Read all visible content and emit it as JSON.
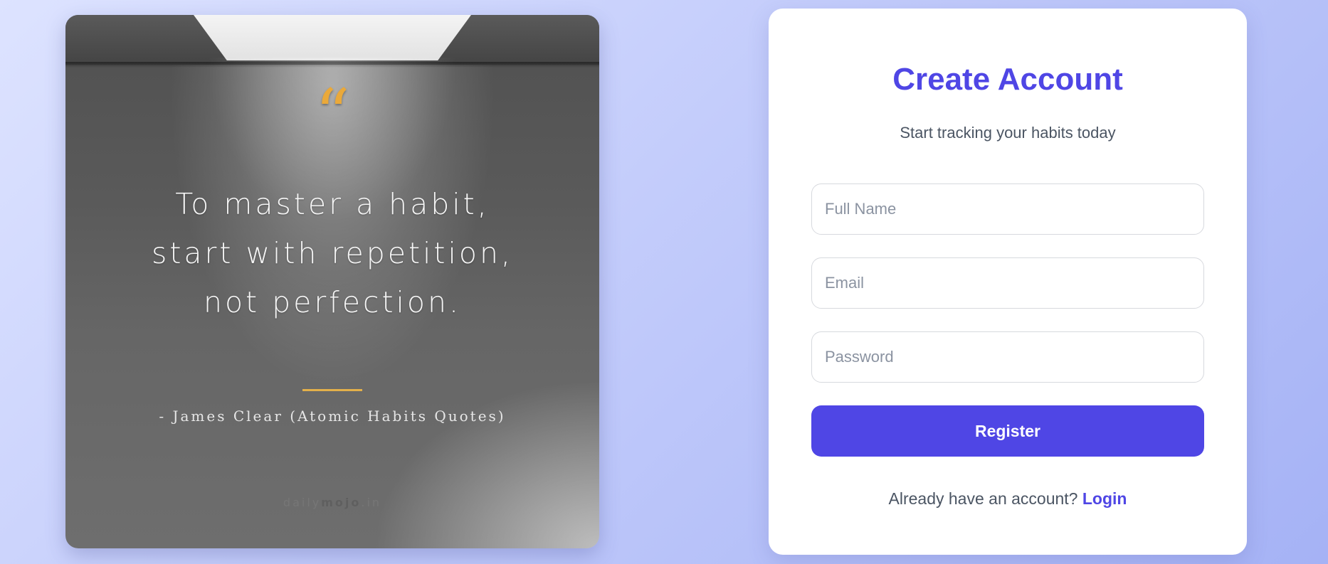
{
  "quote_card": {
    "quote_mark": "“",
    "lines": [
      "To master a habit,",
      "start with repetition,",
      "not perfection."
    ],
    "author": "- James Clear (Atomic Habits Quotes)",
    "watermark_prefix": "daily",
    "watermark_brand": "mojo",
    "watermark_suffix": ".in",
    "accent_color": "#eaa93a"
  },
  "register": {
    "title": "Create Account",
    "subtitle": "Start tracking your habits today",
    "fields": {
      "name": {
        "placeholder": "Full Name",
        "value": ""
      },
      "email": {
        "placeholder": "Email",
        "value": ""
      },
      "password": {
        "placeholder": "Password",
        "value": ""
      }
    },
    "submit_label": "Register",
    "login_prompt": "Already have an account?",
    "login_link": "Login",
    "brand_color": "#4f46e5"
  }
}
